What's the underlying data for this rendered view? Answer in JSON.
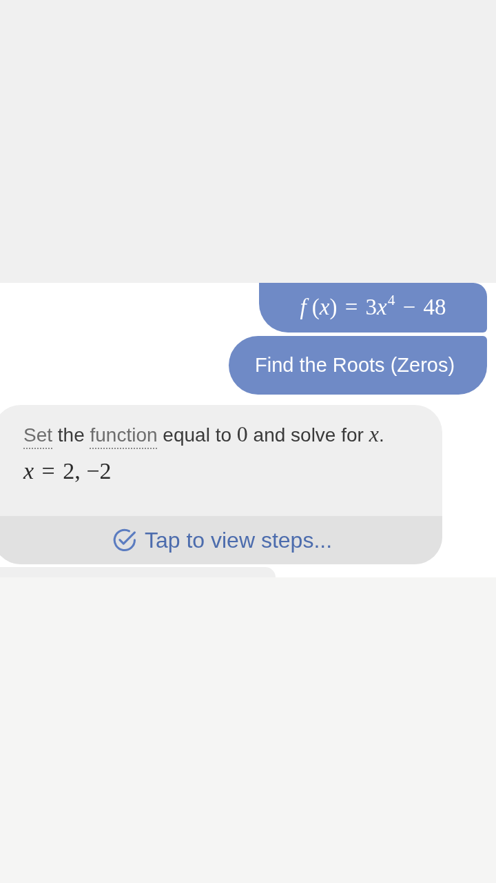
{
  "messages": [
    {
      "kind": "math",
      "parts": [
        {
          "kind": "var",
          "text": "f"
        },
        {
          "kind": "plain",
          "text": " ("
        },
        {
          "kind": "var",
          "text": "x"
        },
        {
          "kind": "plain",
          "text": ")"
        },
        {
          "kind": "op",
          "text": " = "
        },
        {
          "kind": "plain",
          "text": "3"
        },
        {
          "kind": "var",
          "text": "x"
        },
        {
          "kind": "sup",
          "text": "4"
        },
        {
          "kind": "op",
          "text": " − "
        },
        {
          "kind": "plain",
          "text": "48"
        }
      ]
    },
    {
      "kind": "text",
      "text": "Find the Roots (Zeros)"
    }
  ],
  "answer": {
    "explanation": [
      {
        "kind": "term",
        "text": "Set"
      },
      {
        "kind": "text",
        "text": " the "
      },
      {
        "kind": "term",
        "text": "function"
      },
      {
        "kind": "text",
        "text": " equal to "
      },
      {
        "kind": "math",
        "text": "0"
      },
      {
        "kind": "text",
        "text": " and solve for "
      },
      {
        "kind": "var",
        "text": "x"
      },
      {
        "kind": "text",
        "text": "."
      }
    ],
    "result": [
      {
        "kind": "var",
        "text": "x"
      },
      {
        "kind": "op",
        "text": " = "
      },
      {
        "kind": "plain",
        "text": "2, −2"
      }
    ],
    "steps_button": "Tap to view steps..."
  }
}
